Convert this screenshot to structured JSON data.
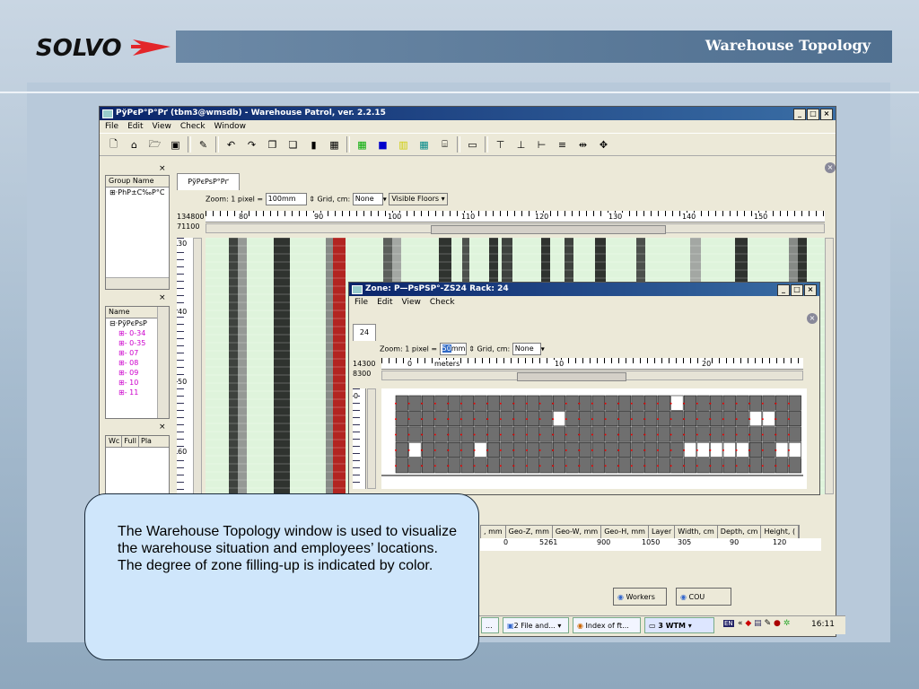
{
  "slide": {
    "title": "Warehouse Topology",
    "callout": "The Warehouse Topology window is used to visualize the warehouse situation and employees’ locations. The degree of zone filling-up is indicated by color.",
    "colors": {
      "header_bar": "#5c7b9b",
      "callout_bg": "#cfe6fb",
      "logo_red": "#e3262a"
    }
  },
  "main_window": {
    "title": "РўРєР°Р°Рґ (tbm3@wmsdb) - Warehouse Patrol, ver. 2.2.15",
    "menu": [
      "File",
      "Edit",
      "View",
      "Check",
      "Window"
    ],
    "group_pane_header": "Group Name",
    "group_pane_item": "PhP±C‰P°C",
    "tree_pane_header": "Name",
    "tree_root": "РўРєРѕР",
    "tree_items": [
      "0-34",
      "0-35",
      "07",
      "08",
      "09",
      "10",
      "11"
    ],
    "tab_label": "РўРєРѕР°Рґ",
    "zoom_label": "Zoom: 1 pixel =",
    "zoom_value": "100mm",
    "grid_label": "Grid, cm:",
    "grid_value": "None",
    "floors_button": "Visible Floors",
    "coord_x": "134800",
    "coord_y": "71100",
    "ruler_ticks": [
      "80",
      "90",
      "100",
      "110",
      "120",
      "130",
      "140",
      "150"
    ],
    "vruler_ticks": [
      "30",
      "40",
      "50",
      "60"
    ],
    "lower_pane_cols": [
      "Wc",
      "Full",
      "Pla"
    ],
    "grid_columns": [
      ", mm",
      "Geo-Z, mm",
      "Geo-W, mm",
      "Geo-H, mm",
      "Layer",
      "Width, cm",
      "Depth, cm",
      "Height, ("
    ],
    "grid_row": [
      "0",
      "5261",
      "900",
      "1050",
      "305",
      "90",
      "120"
    ],
    "bottom_buttons": {
      "workers": "Workers",
      "cou": "COU"
    }
  },
  "zone_window": {
    "title": "Zone: Р—РѕРЅР°-ZS24 Rack: 24",
    "menu": [
      "File",
      "Edit",
      "View",
      "Check"
    ],
    "tab_label": "24",
    "zoom_label": "Zoom: 1 pixel =",
    "zoom_value": "50",
    "zoom_unit": "mm",
    "grid_label": "Grid, cm:",
    "grid_value": "None",
    "coord_x": "14300",
    "coord_y": "8300",
    "ruler_labels": [
      "0",
      "meters",
      "10",
      "20"
    ],
    "vruler_label": "0",
    "rack": {
      "rows": 5,
      "cols": 31,
      "empty_cells": [
        [
          0,
          21
        ],
        [
          1,
          12
        ],
        [
          1,
          27
        ],
        [
          1,
          28
        ],
        [
          3,
          1
        ],
        [
          3,
          6
        ],
        [
          3,
          22
        ],
        [
          3,
          23
        ],
        [
          3,
          24
        ],
        [
          3,
          25
        ],
        [
          3,
          26
        ],
        [
          3,
          29
        ],
        [
          3,
          30
        ]
      ]
    }
  },
  "taskbar": {
    "items": [
      "...",
      "2 File and...",
      "Index of ft...",
      "3 WTM"
    ],
    "tray_lang": "EN",
    "clock": "16:11"
  }
}
